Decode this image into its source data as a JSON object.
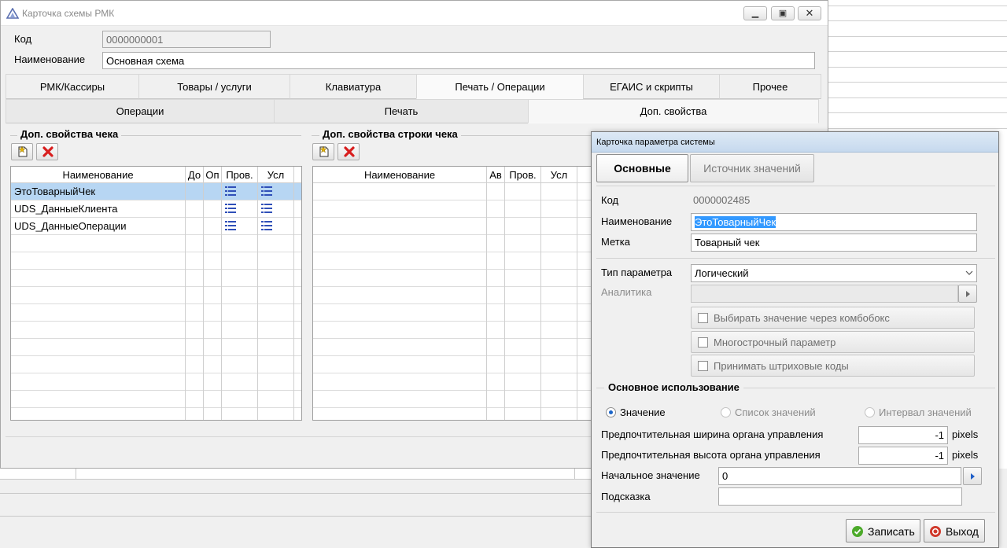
{
  "main_window": {
    "title": "Карточка схемы РМК",
    "code_label": "Код",
    "code_value": "0000000001",
    "name_label": "Наименование",
    "name_value": "Основная схема",
    "tabs": [
      {
        "label": "РМК/Кассиры"
      },
      {
        "label": "Товары / услуги"
      },
      {
        "label": "Клавиатура"
      },
      {
        "label": "Печать / Операции",
        "active": true
      },
      {
        "label": "ЕГАИС и скрипты"
      },
      {
        "label": "Прочее"
      }
    ],
    "subtabs": [
      {
        "label": "Операции"
      },
      {
        "label": "Печать"
      },
      {
        "label": "Доп. свойства",
        "active": true
      }
    ],
    "check_props": {
      "title": "Доп. свойства чека",
      "columns": [
        "Наименование",
        "До",
        "Оп",
        "Пров.",
        "Усл"
      ],
      "rows": [
        {
          "name": "ЭтоТоварныйЧек",
          "selected": true
        },
        {
          "name": "UDS_ДанныеКлиента"
        },
        {
          "name": "UDS_ДанныеОперации"
        }
      ]
    },
    "line_props": {
      "title": "Доп. свойства строки чека",
      "columns": [
        "Наименование",
        "Ав",
        "Пров.",
        "Усл"
      ]
    }
  },
  "dialog": {
    "title": "Карточка параметра системы",
    "tabs": {
      "main": "Основные",
      "source": "Источник значений"
    },
    "code_label": "Код",
    "code_value": "0000002485",
    "name_label": "Наименование",
    "name_value": "ЭтоТоварныйЧек",
    "tag_label": "Метка",
    "tag_value": "Товарный чек",
    "param_type_label": "Тип параметра",
    "param_type_value": "Логический",
    "analytics_label": "Аналитика",
    "checkboxes": {
      "combobox": "Выбирать значение через комбобокс",
      "multiline": "Многострочный параметр",
      "barcodes": "Принимать штриховые коды"
    },
    "usage_title": "Основное использование",
    "radios": {
      "value": "Значение",
      "list": "Список значений",
      "interval": "Интервал значений"
    },
    "pref_width_label": "Предпочтительная ширина органа управления",
    "pref_width_value": "-1",
    "pref_height_label": "Предпочтительная высота органа управления",
    "pref_height_value": "-1",
    "pixels_unit": "pixels",
    "initial_value_label": "Начальное значение",
    "initial_value": "0",
    "hint_label": "Подсказка",
    "hint_value": "",
    "save_button": "Записать",
    "exit_button": "Выход"
  },
  "colors": {
    "selection": "#b7d6f3",
    "list_icon": "#2f4fb8",
    "delete_icon": "#d81e1e",
    "add_icon": "#d9a400",
    "save_icon": "#3a9a1f",
    "exit_icon": "#c0392b"
  }
}
